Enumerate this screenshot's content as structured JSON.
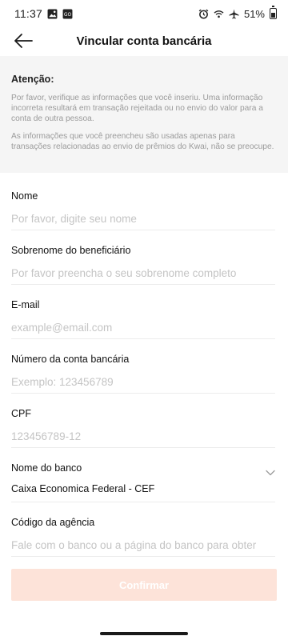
{
  "status_bar": {
    "time": "11:37",
    "battery": "51%"
  },
  "header": {
    "title": "Vincular conta bancária"
  },
  "notice": {
    "title": "Atenção:",
    "paragraph1": "Por favor, verifique as informações que você inseriu. Uma informação incorreta resultará em transação rejeitada ou no envio do valor para a conta de outra pessoa.",
    "paragraph2": "As informações que você preencheu são usadas apenas para transações relacionadas ao envio de prêmios do Kwai, não se preocupe."
  },
  "form": {
    "name": {
      "label": "Nome",
      "placeholder": "Por favor, digite seu nome",
      "value": ""
    },
    "surname": {
      "label": "Sobrenome do beneficiário",
      "placeholder": "Por favor preencha o seu sobrenome completo",
      "value": ""
    },
    "email": {
      "label": "E-mail",
      "placeholder": "example@email.com",
      "value": ""
    },
    "account_number": {
      "label": "Número da conta bancária",
      "placeholder": "Exemplo: 123456789",
      "value": ""
    },
    "cpf": {
      "label": "CPF",
      "placeholder": "123456789-12",
      "value": ""
    },
    "bank": {
      "label": "Nome do banco",
      "value": "Caixa Economica Federal - CEF"
    },
    "agency": {
      "label": "Código da agência",
      "placeholder": "Fale com o banco ou a página do banco para obter",
      "value": ""
    }
  },
  "confirm_label": "Confirmar",
  "colors": {
    "accent_disabled": "#fde3d9",
    "notice_bg": "#f5f5f5",
    "placeholder": "#c4c4c4"
  }
}
